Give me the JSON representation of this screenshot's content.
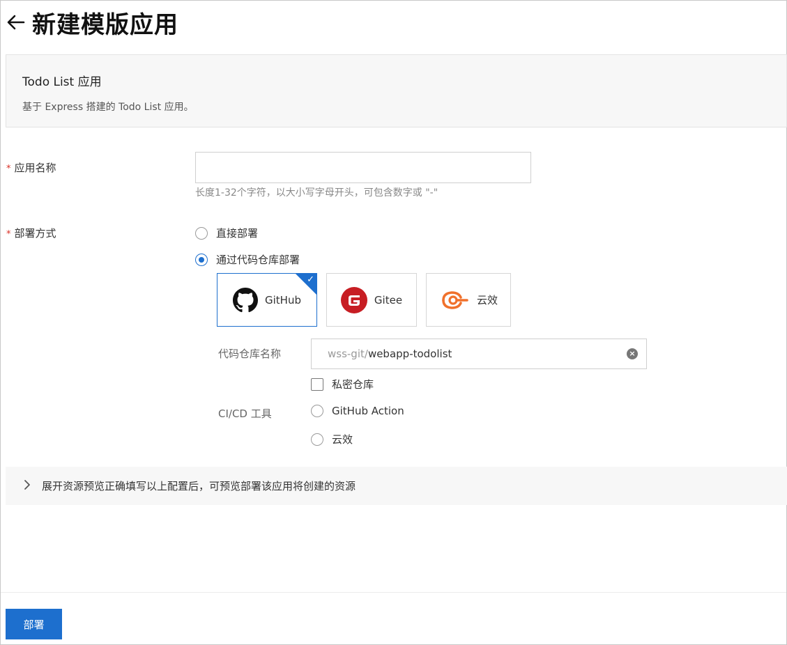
{
  "header": {
    "title": "新建模版应用"
  },
  "template": {
    "name": "Todo List 应用",
    "description": "基于 Express 搭建的 Todo List 应用。"
  },
  "form": {
    "app_name": {
      "required_mark": "*",
      "label": "应用名称",
      "value": "",
      "placeholder": "",
      "hint": "长度1-32个字符，以大小写字母开头，可包含数字或 \"-\""
    },
    "deploy_method": {
      "required_mark": "*",
      "label": "部署方式",
      "options": [
        {
          "label": "直接部署",
          "selected": false
        },
        {
          "label": "通过代码仓库部署",
          "selected": true
        }
      ]
    },
    "providers": [
      {
        "name": "GitHub",
        "icon": "github-icon",
        "selected": true
      },
      {
        "name": "Gitee",
        "icon": "gitee-icon",
        "selected": false
      },
      {
        "name": "云效",
        "icon": "yunxiao-icon",
        "selected": false
      }
    ],
    "repo": {
      "label": "代码仓库名称",
      "prefix": "wss-git/",
      "name": "webapp-todolist",
      "private_label": "私密仓库",
      "private_checked": false
    },
    "cicd": {
      "label": "CI/CD 工具",
      "options": [
        {
          "label": "GitHub Action",
          "selected": false
        },
        {
          "label": "云效",
          "selected": false
        }
      ]
    }
  },
  "preview": {
    "text": "展开资源预览正确填写以上配置后，可预览部署该应用将创建的资源"
  },
  "footer": {
    "deploy_button": "部署"
  },
  "colors": {
    "accent": "#1d6fce",
    "required": "#d93026",
    "gitee": "#c71d23",
    "yunxiao": "#f0712c"
  }
}
